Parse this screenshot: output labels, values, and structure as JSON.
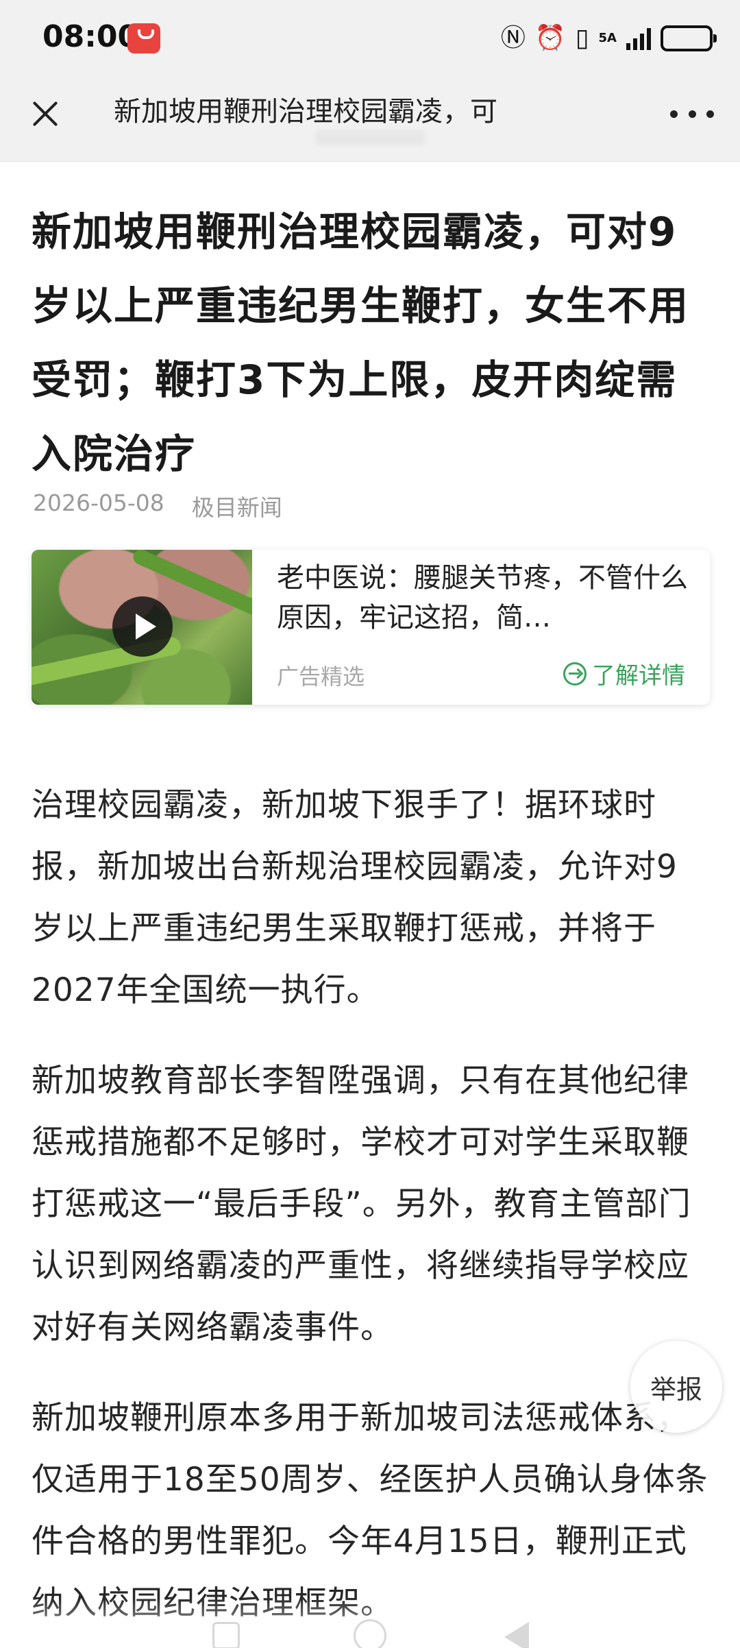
{
  "status_bar": {
    "time": "08:00",
    "network": "5A",
    "icons": [
      "app-gallery-icon",
      "nfc-icon",
      "alarm-icon",
      "vibrate-icon",
      "signal-icon",
      "battery-icon"
    ]
  },
  "nav": {
    "title": "新加坡用鞭刑治理校园霸凌，可"
  },
  "article": {
    "headline": "新加坡用鞭刑治理校园霸凌，可对9岁以上严重违纪男生鞭打，女生不用受罚；鞭打3下为上限，皮开肉绽需入院治疗",
    "date": "2026-05-08",
    "source": "极目新闻",
    "paragraphs": [
      "治理校园霸凌，新加坡下狠手了！据环球时报，新加坡出台新规治理校园霸凌，允许对9岁以上严重违纪男生采取鞭打惩戒，并将于2027年全国统一执行。",
      "新加坡教育部长李智陞强调，只有在其他纪律惩戒措施都不足够时，学校才可对学生采取鞭打惩戒这一“最后手段”。另外，教育主管部门认识到网络霸凌的严重性，将继续指导学校应对好有关网络霸凌事件。",
      "新加坡鞭刑原本多用于新加坡司法惩戒体系，仅适用于18至50周岁、经医护人员确认身体条件合格的男性罪犯。今年4月15日，鞭刑正式纳入校园纪律治理框架。"
    ]
  },
  "ad": {
    "text": "老中医说：腰腿关节疼，不管什么原因，牢记这招，简…",
    "label": "广告精选",
    "link": "了解详情",
    "link_color": "#3aa35c"
  },
  "report_button": "举报"
}
